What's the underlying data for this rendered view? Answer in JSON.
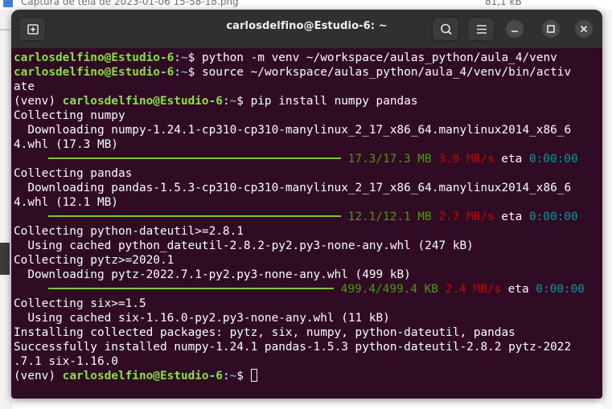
{
  "background": {
    "file_name": "Captura de tela de 2023-01-06 15-58-18.png",
    "file_size": "81,1 kB"
  },
  "window": {
    "title": "carlosdelfino@Estudio-6: ~",
    "new_tab_icon": "new-tab-icon",
    "search_icon": "search-icon",
    "menu_icon": "hamburger-menu-icon",
    "minimize_icon": "minimize-icon",
    "maximize_icon": "maximize-icon",
    "close_icon": "close-icon"
  },
  "colors": {
    "terminal_bg": "#2f0b24",
    "titlebar_bg": "#303030",
    "prompt_user": "#8ae234",
    "prompt_path": "#729fcf",
    "progress_bar": "#73d216",
    "speed": "#cc0000",
    "eta": "#06989a"
  },
  "terminal": {
    "prompt_user": "carlosdelfino@Estudio-6",
    "prompt_path": "~",
    "venv_prefix": "(venv) ",
    "cmd1": "python -m venv ~/workspace/aulas_python/aula_4/venv",
    "cmd2a": "source ~/workspace/aulas_python/aula_4/venv/bin/activ",
    "cmd2b": "ate",
    "cmd3": "pip install numpy pandas",
    "collect_numpy": "Collecting numpy",
    "dl_numpy_a": "  Downloading numpy-1.24.1-cp310-cp310-manylinux_2_17_x86_64.manylinux2014_x86_6",
    "dl_numpy_b": "4.whl (17.3 MB)",
    "prog_numpy": {
      "size": "17.3/17.3 MB",
      "speed": "3.9 MB/s",
      "eta_label": "eta",
      "eta": "0:00:00"
    },
    "collect_pandas": "Collecting pandas",
    "dl_pandas_a": "  Downloading pandas-1.5.3-cp310-cp310-manylinux_2_17_x86_64.manylinux2014_x86_6",
    "dl_pandas_b": "4.whl (12.1 MB)",
    "prog_pandas": {
      "size": "12.1/12.1 MB",
      "speed": "2.7 MB/s",
      "eta_label": "eta",
      "eta": "0:00:00"
    },
    "collect_dateutil": "Collecting python-dateutil>=2.8.1",
    "cached_dateutil": "  Using cached python_dateutil-2.8.2-py2.py3-none-any.whl (247 kB)",
    "collect_pytz": "Collecting pytz>=2020.1",
    "dl_pytz": "  Downloading pytz-2022.7.1-py2.py3-none-any.whl (499 kB)",
    "prog_pytz": {
      "size": "499.4/499.4 KB",
      "speed": "2.4 MB/s",
      "eta_label": "eta",
      "eta": "0:00:00"
    },
    "collect_six": "Collecting six>=1.5",
    "cached_six": "  Using cached six-1.16.0-py2.py3-none-any.whl (11 kB)",
    "installing": "Installing collected packages: pytz, six, numpy, python-dateutil, pandas",
    "success_a": "Successfully installed numpy-1.24.1 pandas-1.5.3 python-dateutil-2.8.2 pytz-2022",
    "success_b": ".7.1 six-1.16.0"
  }
}
